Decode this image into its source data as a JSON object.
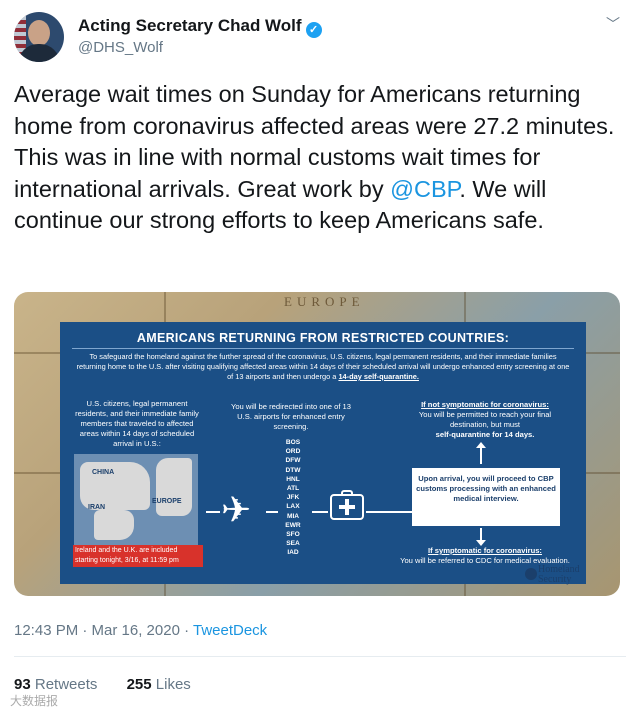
{
  "author": {
    "name": "Acting Secretary Chad Wolf",
    "handle": "@DHS_Wolf",
    "verified_glyph": "✓"
  },
  "menu_glyph": "﹀",
  "tweet": {
    "text_before": "Average wait times on Sunday for Americans returning home from coronavirus affected areas were 27.2 minutes.  This was in line with normal customs wait times for international arrivals.  Great work by ",
    "mention": "@CBP",
    "text_after": ".  We will continue our strong efforts to keep Americans safe."
  },
  "infographic": {
    "map_label": "EUROPE",
    "title": "AMERICANS RETURNING FROM RESTRICTED COUNTRIES:",
    "intro": "To safeguard the homeland against the further spread of the coronavirus, U.S. citizens, legal permanent residents, and their immediate families returning home to the U.S. after visiting qualifying affected areas within 14 days of their scheduled arrival will undergo enhanced entry screening at one of 13 airports and then undergo a",
    "intro_emph": "14-day self-quarantine.",
    "col1": "U.S. citizens, legal permanent residents, and their immediate family members that traveled to affected areas within 14 days of scheduled arrival in U.S.:",
    "map_labels": [
      "CHINA",
      "IRAN",
      "EUROPE"
    ],
    "red_note": "Ireland and the U.K. are included starting tonight, 3/16, at 11:59 pm",
    "col2": "You will be redirected into one of 13 U.S. airports for enhanced entry screening.",
    "airports": [
      "BOS",
      "ORD",
      "DFW",
      "DTW",
      "HNL",
      "ATL",
      "JFK",
      "LAX",
      "MIA",
      "EWR",
      "SFO",
      "SEA",
      "IAD"
    ],
    "not_symptomatic_head": "If not symptomatic for coronavirus:",
    "not_symptomatic_text": "You will be permitted to reach your final destination, but must",
    "not_symptomatic_bold": "self-quarantine for 14 days.",
    "arrival_box": "Upon arrival, you will proceed to CBP customs processing with an enhanced medical interview.",
    "symptomatic_head": "If symptomatic for coronavirus:",
    "symptomatic_text": "You will be referred to CDC for medical evaluation.",
    "logo_text": "Homeland Security"
  },
  "meta": {
    "time": "12:43 PM · Mar 16, 2020 · ",
    "source": "TweetDeck"
  },
  "stats": {
    "retweets_count": "93",
    "retweets_label": "Retweets",
    "likes_count": "255",
    "likes_label": "Likes"
  },
  "watermark": "大数据报"
}
